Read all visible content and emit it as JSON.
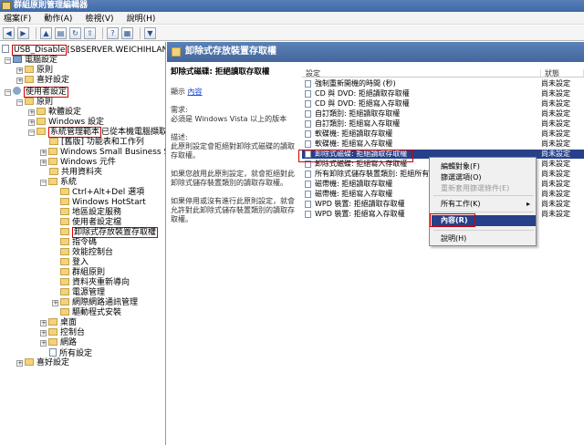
{
  "window": {
    "title": "群組原則管理編輯器"
  },
  "menu": [
    "檔案(F)",
    "動作(A)",
    "檢視(V)",
    "說明(H)"
  ],
  "toolbar": {
    "icons": [
      "back-icon",
      "forward-icon",
      "up-icon",
      "show-tree-icon",
      "refresh-icon",
      "export-icon",
      "help-icon",
      "properties-icon",
      "filter-icon"
    ]
  },
  "tree": {
    "root": "USB_Disable",
    "root_suffix": "[SBSERVER.WEICHIHLAN.LOCA",
    "computer_config": "電腦設定",
    "computer_policies": "原則",
    "computer_preferences": "喜好設定",
    "user_config": "使用者設定",
    "user_policies": "原則",
    "software_settings": "軟體設定",
    "windows_settings": "Windows 設定",
    "admin_templates": "系統管理範本",
    "admin_templates_suffix": "已從本機電腦擷取的",
    "t_ctrl_panel_old": "[舊版] 功能表和工作列",
    "t_sbs": "Windows Small Business Server",
    "t_win_components": "Windows 元件",
    "t_shared_folders": "共用資料夾",
    "t_system": "系統",
    "s_ctrl_alt_del": "Ctrl+Alt+Del 選項",
    "s_hotstart": "Windows HotStart",
    "s_locale": "地區設定服務",
    "s_user_profiles": "使用者設定檔",
    "s_removable": "卸除式存放裝置存取權",
    "s_scripts": "指令碼",
    "s_performance": "效能控制台",
    "s_logon": "登入",
    "s_group_policy": "群組原則",
    "s_folder_redirect": "資料夾重新導向",
    "s_power": "電源管理",
    "s_internet_comm": "網際網路通訊管理",
    "s_driver_install": "驅動程式安裝",
    "t_desktop": "桌面",
    "t_control_panel": "控制台",
    "t_network": "網路",
    "t_all_settings": "所有設定",
    "user_preferences": "喜好設定"
  },
  "details": {
    "header": "卸除式存放裝置存取權",
    "title": "卸除式磁碟: 拒絕讀取存取權",
    "show_label": "顯示",
    "show_link": "內容",
    "req_label": "需求:",
    "req_text": "必須是 Windows Vista 以上的版本",
    "desc_label": "描述:",
    "desc_text": "此原則設定會拒絕對卸除式磁碟的讀取存取權。",
    "enable_text": "如果您啟用此原則設定，就會拒絕對此卸除式儲存裝置類別的讀取存取權。",
    "disable_text": "如果停用或沒有進行此原則設定，就會允許對此卸除式儲存裝置類別的讀取存取權。"
  },
  "list": {
    "col_setting": "設定",
    "col_state": "狀態",
    "rows": [
      {
        "name": "強制重新開機的時間 (秒)",
        "state": "尚未設定"
      },
      {
        "name": "CD 與 DVD: 拒絕讀取存取權",
        "state": "尚未設定"
      },
      {
        "name": "CD 與 DVD: 拒絕寫入存取權",
        "state": "尚未設定"
      },
      {
        "name": "自訂類別: 拒絕讀取存取權",
        "state": "尚未設定"
      },
      {
        "name": "自訂類別: 拒絕寫入存取權",
        "state": "尚未設定"
      },
      {
        "name": "軟碟機: 拒絕讀取存取權",
        "state": "尚未設定"
      },
      {
        "name": "軟碟機: 拒絕寫入存取權",
        "state": "尚未設定"
      },
      {
        "name": "卸除式磁碟: 拒絕讀取存取權",
        "state": "尚未設定"
      },
      {
        "name": "卸除式磁碟: 拒絕寫入存取權",
        "state": "尚未設定"
      },
      {
        "name": "所有卸除式儲存裝置類別: 拒絕所有",
        "state": "尚未設定"
      },
      {
        "name": "磁帶機: 拒絕讀取存取權",
        "state": "尚未設定"
      },
      {
        "name": "磁帶機: 拒絕寫入存取權",
        "state": "尚未設定"
      },
      {
        "name": "WPD 裝置: 拒絕讀取存取權",
        "state": "尚未設定"
      },
      {
        "name": "WPD 裝置: 拒絕寫入存取權",
        "state": "尚未設定"
      }
    ]
  },
  "context_menu": {
    "edit": "編輯對象(F)",
    "filter": "篩選選項(O)",
    "reapply": "重新套用篩選條件(E)",
    "all_tasks": "所有工作(K)",
    "properties": "內容(R)",
    "help": "說明(H)"
  },
  "colors": {
    "selection": "#26408a",
    "header": "#4d73aa",
    "highlight": "#d00000"
  }
}
